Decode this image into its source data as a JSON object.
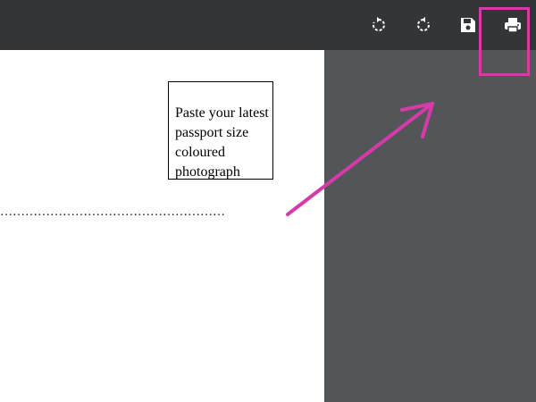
{
  "toolbar": {
    "buttons": [
      {
        "name": "rotate-clockwise",
        "icon": "rotate-clockwise-icon"
      },
      {
        "name": "rotate-counterclockwise",
        "icon": "rotate-counterclockwise-icon"
      },
      {
        "name": "save",
        "icon": "save-icon"
      },
      {
        "name": "print",
        "icon": "print-icon"
      }
    ]
  },
  "document": {
    "photo_box_text": "Paste your latest passport size coloured photograph",
    "dotted_line": "………………………………………………"
  },
  "annotation": {
    "color": "#d63aa9",
    "highlight_target": "print-button"
  },
  "colors": {
    "toolbar_bg": "#323639",
    "viewer_bg": "#525659",
    "page_bg": "#ffffff",
    "icon_color": "#ffffff"
  }
}
